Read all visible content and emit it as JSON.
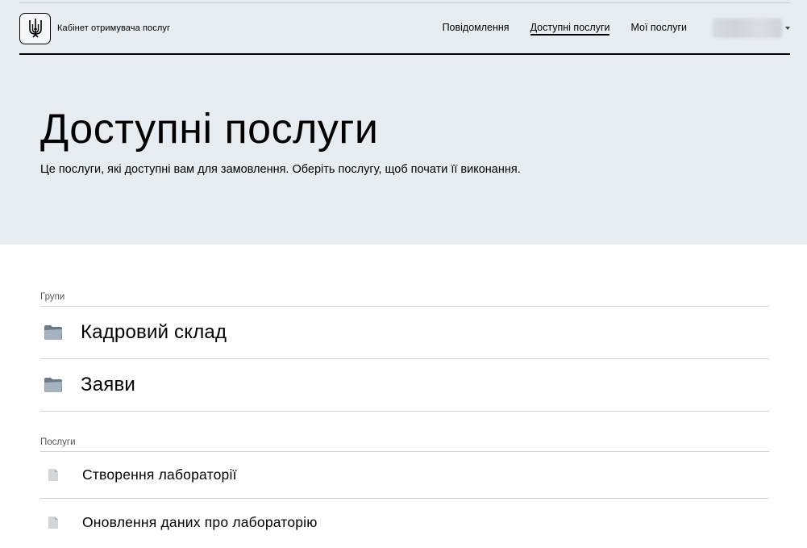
{
  "header": {
    "brand": "Кабінет отримувача послуг",
    "nav": [
      {
        "label": "Повідомлення",
        "active": false
      },
      {
        "label": "Доступні послуги",
        "active": true
      },
      {
        "label": "Мої послуги",
        "active": false
      }
    ],
    "logo_icon": "trident-icon",
    "user_caret_icon": "caret-down-icon"
  },
  "page": {
    "title": "Доступні послуги",
    "subtitle": "Це послуги, які доступні вам для замовлення. Оберіть послугу, щоб почати її виконання."
  },
  "groups": {
    "label": "Групи",
    "items": [
      {
        "label": "Кадровий склад",
        "icon": "folder-icon"
      },
      {
        "label": "Заяви",
        "icon": "folder-icon"
      }
    ]
  },
  "services": {
    "label": "Послуги",
    "items": [
      {
        "label": "Створення лабораторії",
        "icon": "document-icon"
      },
      {
        "label": "Оновлення даних про лабораторію",
        "icon": "document-icon"
      }
    ]
  },
  "colors": {
    "hero_bg": "#e7ecf1",
    "divider": "#cfd3d8",
    "text": "#000000"
  }
}
